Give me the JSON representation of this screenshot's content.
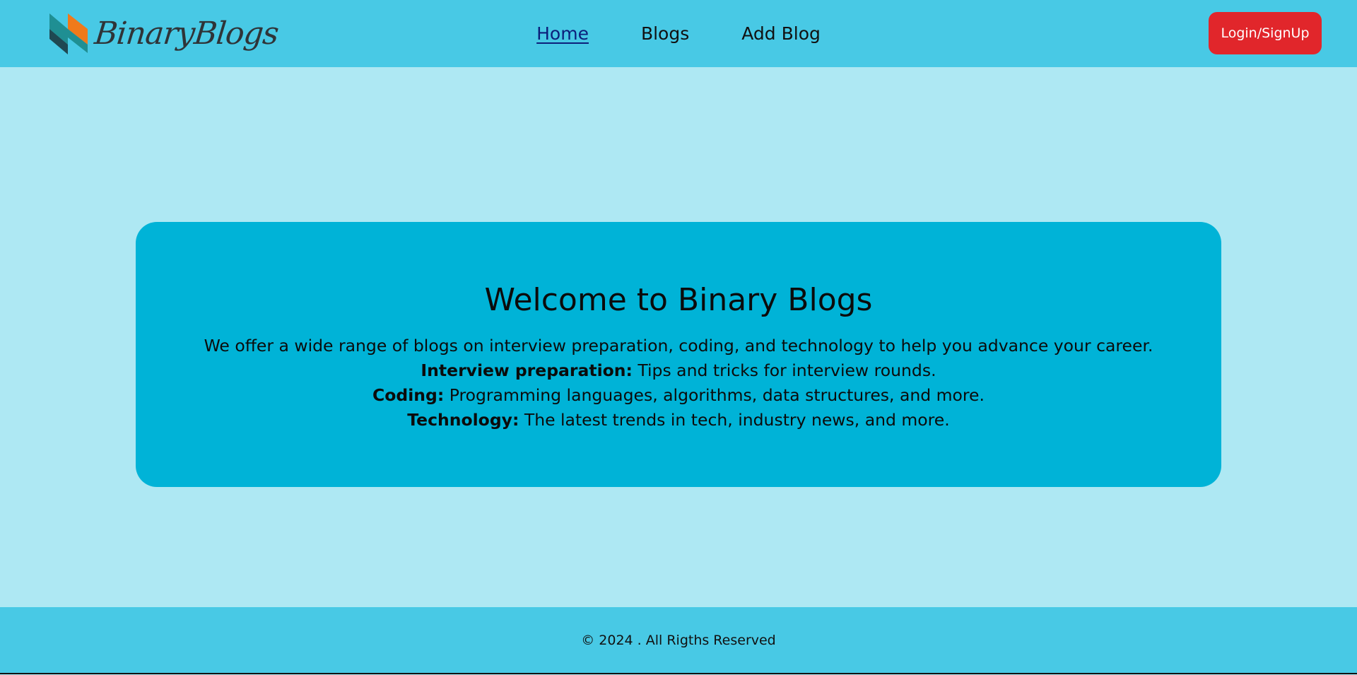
{
  "header": {
    "logo_text": "BinaryBlogs",
    "nav": [
      {
        "label": "Home",
        "active": true
      },
      {
        "label": "Blogs",
        "active": false
      },
      {
        "label": "Add Blog",
        "active": false
      }
    ],
    "login_label": "Login/SignUp"
  },
  "hero": {
    "title": "Welcome to Binary Blogs",
    "intro": "We offer a wide range of blogs on interview preparation, coding, and technology to help you advance your career.",
    "items": [
      {
        "term": "Interview preparation:",
        "desc": " Tips and tricks for interview rounds."
      },
      {
        "term": "Coding:",
        "desc": " Programming languages, algorithms, data structures, and more."
      },
      {
        "term": "Technology:",
        "desc": " The latest trends in tech, industry news, and more."
      }
    ]
  },
  "footer": {
    "text": "© 2024 . All Rigths Reserved"
  },
  "colors": {
    "header_bg": "#48c9e5",
    "page_bg": "#aee8f3",
    "hero_bg": "#00b3d7",
    "login_bg": "#e1262b",
    "logo_orange": "#f07a1a",
    "logo_teal": "#1f8f93",
    "logo_dark": "#1f4852"
  },
  "icons": {
    "logo_mark": "binary-blogs-logo-mark"
  }
}
